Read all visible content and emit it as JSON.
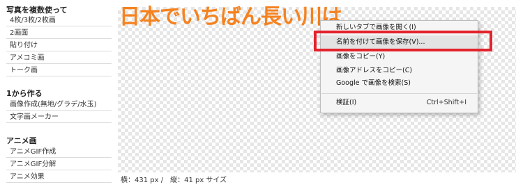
{
  "sidebar": {
    "sections": [
      {
        "title": "写真を複数使って",
        "items": [
          "4枚/3枚/2枚画",
          "2画面",
          "貼り付け",
          "アメコミ画",
          "トーク画"
        ]
      },
      {
        "title": "1から作る",
        "items": [
          "画像作成(無地/グラデ/水玉)",
          "文字画メーカー"
        ]
      },
      {
        "title": "アニメ画",
        "items": [
          "アニメGIF作成",
          "アニメGIF分解",
          "アニメ効果"
        ]
      }
    ]
  },
  "canvas": {
    "text": "日本でいちばん長い川は",
    "text_color": "#f58220"
  },
  "size_info": "横：431 px /　縦：41 px サイズ",
  "context_menu": {
    "items": [
      {
        "label": "新しいタブで画像を開く(I)",
        "shortcut": ""
      },
      {
        "label": "名前を付けて画像を保存(V)...",
        "shortcut": ""
      },
      {
        "label": "画像をコピー(Y)",
        "shortcut": ""
      },
      {
        "label": "画像アドレスをコピー(C)",
        "shortcut": ""
      },
      {
        "label": "Google で画像を検索(S)",
        "shortcut": ""
      },
      {
        "label": "検証(I)",
        "shortcut": "Ctrl+Shift+I"
      }
    ],
    "highlight_color": "#e3232c"
  }
}
